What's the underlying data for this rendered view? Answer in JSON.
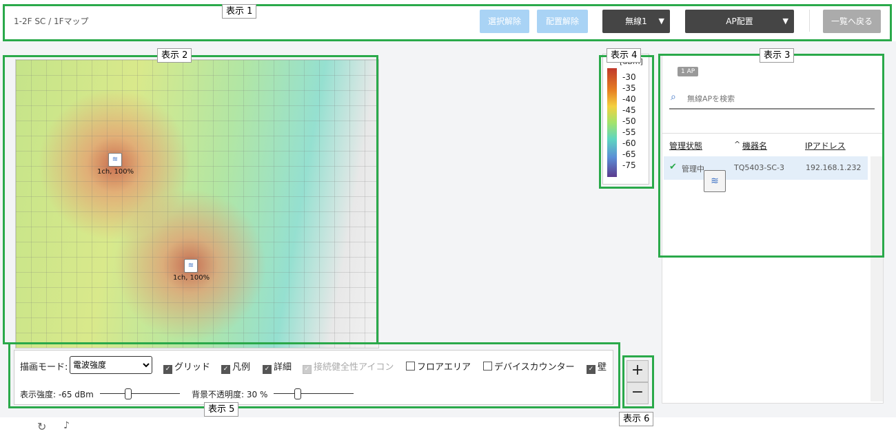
{
  "header": {
    "breadcrumb": "1-2F SC  /  1Fマップ",
    "btn_deselect": "選択解除",
    "btn_unplace": "配置解除",
    "radio_select": "無線1",
    "mode_select": "AP配置",
    "btn_back": "一覧へ戻る"
  },
  "annotations": {
    "label1": "表示 1",
    "label2": "表示 2",
    "label3": "表示 3",
    "label4": "表示 4",
    "label5": "表示 5",
    "label6": "表示 6"
  },
  "map": {
    "aps": [
      {
        "label": "1ch, 100%"
      },
      {
        "label": "1ch, 100%"
      }
    ]
  },
  "legend": {
    "unit": "[dBm]",
    "ticks": [
      "-30",
      "-35",
      "-40",
      "-45",
      "-50",
      "-55",
      "-60",
      "-65",
      "-75"
    ]
  },
  "panel": {
    "count_badge": "1 AP",
    "search_placeholder": "無線APを検索",
    "col_status": "管理状態",
    "col_name": "機器名",
    "col_ip": "IPアドレス",
    "row": {
      "status": "管理中",
      "name": "TQ5403-SC-3",
      "ip": "192.168.1.232"
    }
  },
  "controls": {
    "mode_label": "描画モード:",
    "mode_value": "電波強度",
    "chk_grid": "グリッド",
    "chk_legend": "凡例",
    "chk_detail": "詳細",
    "chk_health": "接続健全性アイコン",
    "chk_floor": "フロアエリア",
    "chk_counter": "デバイスカウンター",
    "chk_wall": "壁",
    "strength_label": "表示強度: -65 dBm",
    "opacity_label": "背景不透明度: 30 %"
  },
  "zoom": {
    "plus": "+",
    "minus": "−"
  }
}
